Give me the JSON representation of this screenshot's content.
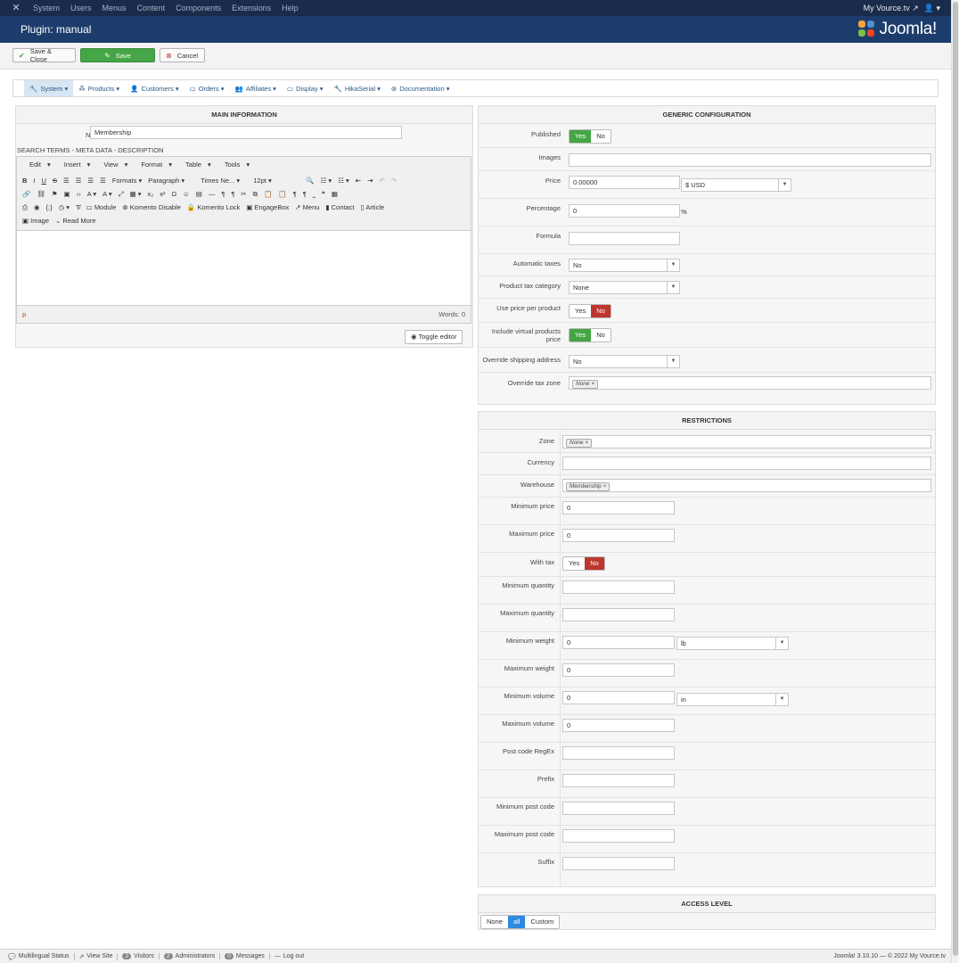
{
  "topbar": {
    "menu": [
      "System",
      "Users",
      "Menus",
      "Content",
      "Components",
      "Extensions",
      "Help"
    ],
    "site_link": "My Vource.tv",
    "user_icon": "user-icon"
  },
  "header": {
    "title": "Plugin: manual",
    "logo_text": "Joomla!"
  },
  "toolbar": {
    "save_close": "Save & Close",
    "save": "Save",
    "cancel": "Cancel"
  },
  "hikamenu": [
    "System",
    "Products",
    "Customers",
    "Orders",
    "Affiliates",
    "Display",
    "HikaSerial",
    "Documentation"
  ],
  "main_info": {
    "heading": "MAIN INFORMATION",
    "name_label": "Name",
    "name_value": "Membership",
    "search_terms": "SEARCH TERMS - META DATA - DESCRIPTION"
  },
  "editor": {
    "menubar": [
      "Edit",
      "Insert",
      "View",
      "Format",
      "Table",
      "Tools"
    ],
    "formats": "Formats",
    "paragraph": "Paragraph",
    "font": "Times Ne...",
    "size": "12pt",
    "buttons": [
      "Module",
      "Komento Disable",
      "Komento Lock",
      "EngageBox",
      "Menu",
      "Contact",
      "Article"
    ],
    "buttons2": [
      "Image",
      "Read More"
    ],
    "path": "p",
    "words": "Words: 0",
    "toggle": "Toggle editor"
  },
  "generic": {
    "heading": "GENERIC CONFIGURATION",
    "published": "Published",
    "images": "Images",
    "price": "Price",
    "price_value": "0.00000",
    "currency_value": "$ USD",
    "percentage": "Percentage",
    "percentage_value": "0",
    "percent_sign": "%",
    "formula": "Formula",
    "automatic_taxes": "Automatic taxes",
    "automatic_taxes_value": "No",
    "product_tax_category": "Product tax category",
    "product_tax_value": "None",
    "use_price_per_product": "Use price per product",
    "include_virtual": "Include virtual products price",
    "override_shipping": "Override shipping address",
    "override_shipping_value": "No",
    "override_tax_zone": "Override tax zone",
    "override_tax_zone_tag": "None",
    "yes": "Yes",
    "no": "No"
  },
  "restrictions": {
    "heading": "RESTRICTIONS",
    "zone": "Zone",
    "zone_tag": "None",
    "currency": "Currency",
    "warehouse": "Warehouse",
    "warehouse_tag": "Membership",
    "min_price": "Minimum price",
    "min_price_value": "0",
    "max_price": "Maximum price",
    "max_price_value": "0",
    "with_tax": "With tax",
    "min_qty": "Minimum quantity",
    "max_qty": "Maximum quantity",
    "min_weight": "Minimum weight",
    "min_weight_value": "0",
    "weight_unit": "lb",
    "max_weight": "Maximum weight",
    "max_weight_value": "0",
    "min_volume": "Minimum volume",
    "min_volume_value": "0",
    "volume_unit": "in",
    "max_volume": "Maximum volume",
    "max_volume_value": "0",
    "postcode_regex": "Post code RegEx",
    "prefix": "Prefix",
    "min_postcode": "Minimum post code",
    "max_postcode": "Maximum post code",
    "suffix": "Suffix"
  },
  "access": {
    "heading": "ACCESS LEVEL",
    "none": "None",
    "all": "all",
    "custom": "Custom"
  },
  "statusbar": {
    "multilingual": "Multilingual Status",
    "view_site": "View Site",
    "visitors_count": "2",
    "visitors": "Visitors",
    "admins_count": "2",
    "admins": "Administrators",
    "messages_count": "0",
    "messages": "Messages",
    "logout": "Log out",
    "version": "Joomla! 3.10.10 — © 2022 My Vource.tv"
  },
  "colors": {
    "navbar": "#1b2b4b",
    "header": "#1c3d6b",
    "yes_green": "#46a546",
    "no_red": "#bd362f",
    "access_blue": "#2d8ae0"
  }
}
